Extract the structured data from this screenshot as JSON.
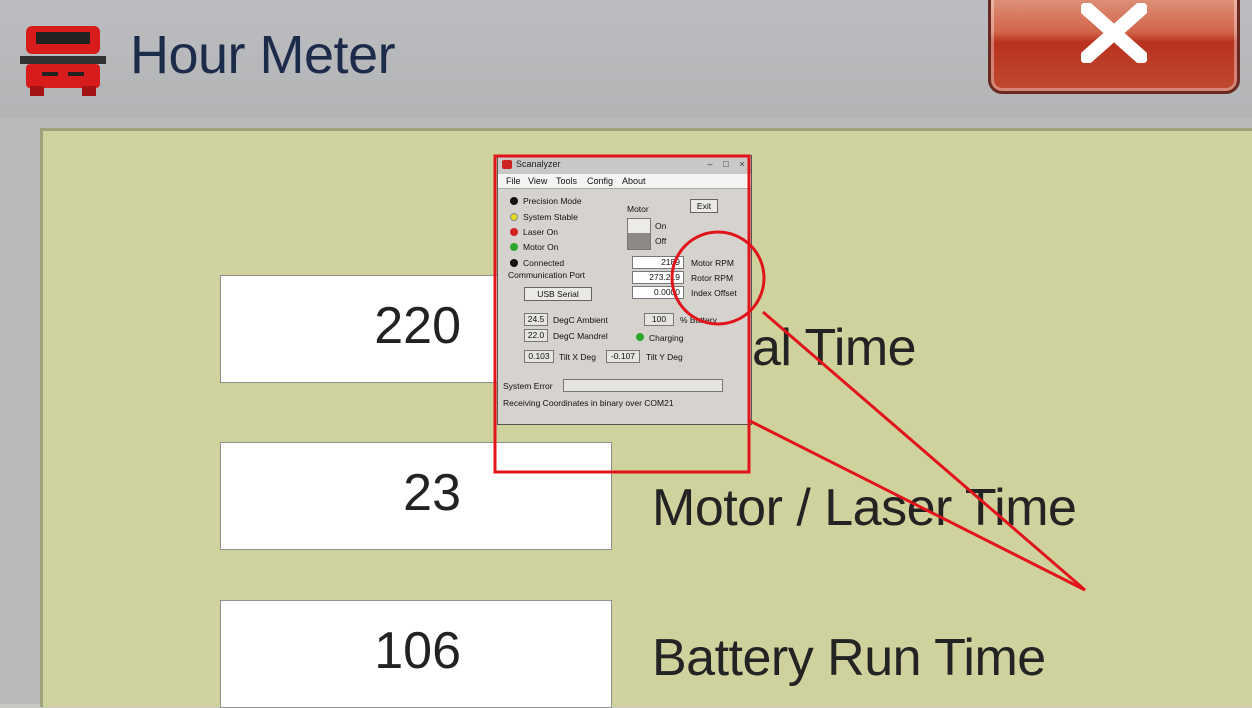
{
  "window": {
    "title": "Hour Meter",
    "close_label": "X"
  },
  "rows": [
    {
      "value": "220",
      "label": "al Time"
    },
    {
      "value": "23",
      "label": "Motor / Laser Time"
    },
    {
      "value": "106",
      "label": "Battery Run Time"
    }
  ],
  "inset": {
    "title": "Scanalyzer",
    "menu": [
      "File",
      "View",
      "Tools",
      "Config",
      "About"
    ],
    "indicators": [
      {
        "label": "Precision Mode",
        "color": "#111111"
      },
      {
        "label": "System Stable",
        "color": "#e8d820"
      },
      {
        "label": "Laser On",
        "color": "#d42020"
      },
      {
        "label": "Motor On",
        "color": "#2ba82b"
      },
      {
        "label": "Connected",
        "color": "#111111"
      }
    ],
    "motor_label": "Motor",
    "exit_label": "Exit",
    "on_label": "On",
    "off_label": "Off",
    "comm_port_label": "Communication Port",
    "comm_port_value": "USB Serial",
    "readouts": [
      {
        "value": "2189",
        "label": "Motor RPM"
      },
      {
        "value": "273.219",
        "label": "Rotor RPM"
      },
      {
        "value": "0.0000",
        "label": "Index Offset"
      }
    ],
    "ambient_value": "24.5",
    "ambient_label": "DegC Ambient",
    "battery_value": "100",
    "battery_label": "% Battery",
    "mandrel_value": "22.0",
    "mandrel_label": "DegC Mandrel",
    "charging_label": "Charging",
    "tilt_x_value": "0.103",
    "tilt_x_label": "Tilt X Deg",
    "tilt_y_value": "-0.107",
    "tilt_y_label": "Tilt Y Deg",
    "system_error_label": "System Error",
    "status_text": "Receiving Coordinates in binary over COM21"
  },
  "colors": {
    "client_bg": "#d0d29e",
    "annotation": "#e2141b",
    "close_button": "#c8402a"
  },
  "icons": {
    "app": "red-vehicle-icon",
    "close": "close-icon"
  }
}
